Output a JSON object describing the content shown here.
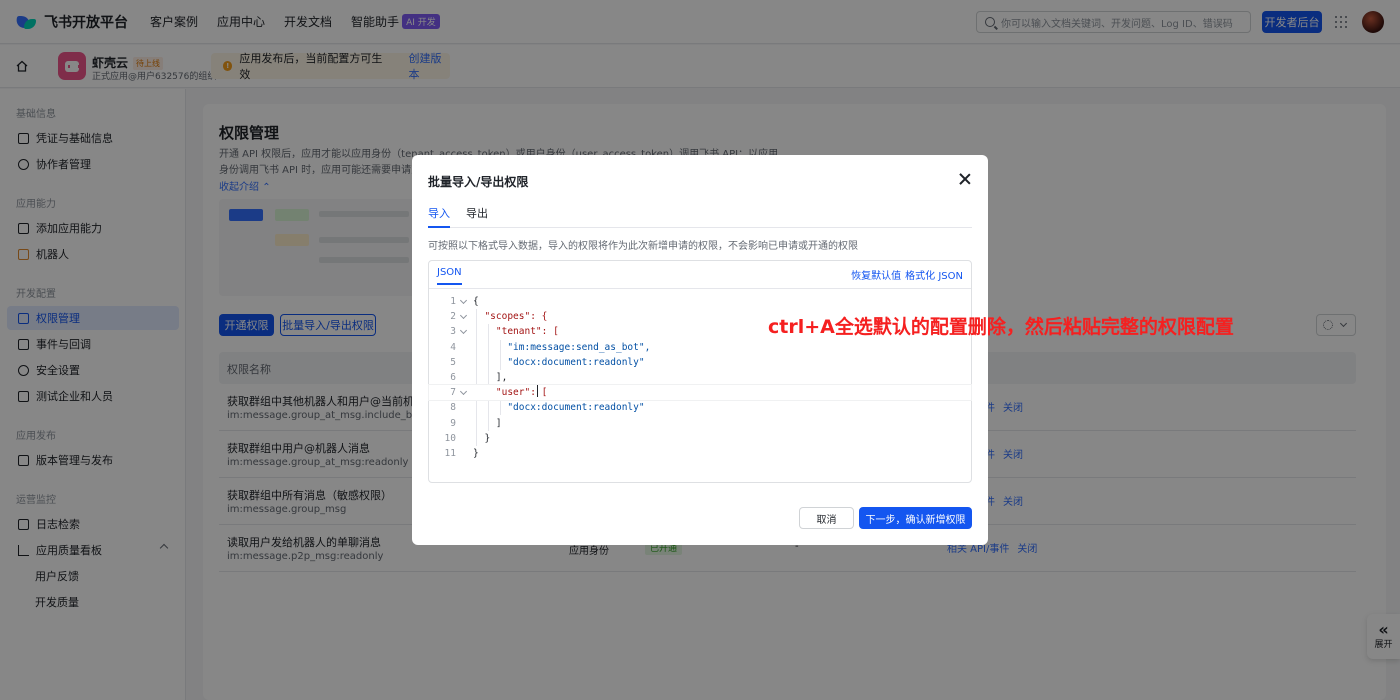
{
  "topnav": {
    "logo_text": "飞书开放平台",
    "links": [
      "客户案例",
      "应用中心",
      "开发文档",
      "智能助手"
    ],
    "ai_badge": "AI 开发",
    "search_placeholder": "你可以输入文档关键词、开发问题、Log ID、错误码",
    "dev_console": "开发者后台"
  },
  "app": {
    "name": "虾壳云",
    "status": "待上线",
    "org": "正式应用@用户632576的组织",
    "notice": "应用发布后，当前配置方可生效",
    "notice_link": "创建版本"
  },
  "sidebar": {
    "groups": [
      "基础信息",
      "应用能力",
      "开发配置",
      "应用发布",
      "运营监控"
    ],
    "items": [
      "凭证与基础信息",
      "协作者管理",
      "添加应用能力",
      "机器人",
      "权限管理",
      "事件与回调",
      "安全设置",
      "测试企业和人员",
      "版本管理与发布",
      "日志检索",
      "应用质量看板",
      "用户反馈",
      "开发质量"
    ]
  },
  "page": {
    "title": "权限管理",
    "desc": "开通 API 权限后，应用才能以应用身份（tenant_access_token）或用户身份（user_access_token）调用飞书 API；以应用身份调用飞书 API 时，应用可能还需要申请对应的数据权限",
    "collapse": "收起介绍",
    "btn_open": "开通权限",
    "btn_batch": "批量导入/导出权限",
    "th_name": "权限名称",
    "rows": [
      {
        "name": "获取群组中其他机器人和用户@当前机器人的消息",
        "code": "im:message.group_at_msg.include_bot:readonly",
        "type": "",
        "status": "",
        "dash": "",
        "act1": "事件",
        "act2": "关闭"
      },
      {
        "name": "获取群组中用户@机器人消息",
        "code": "im:message.group_at_msg:readonly",
        "type": "",
        "status": "",
        "dash": "",
        "act1": "事件",
        "act2": "关闭"
      },
      {
        "name": "获取群组中所有消息（敏感权限）",
        "code": "im:message.group_msg",
        "type": "",
        "status": "",
        "dash": "",
        "act1": "事件",
        "act2": "关闭"
      },
      {
        "name": "读取用户发给机器人的单聊消息",
        "code": "im:message.p2p_msg:readonly",
        "type": "应用身份",
        "status": "已开通",
        "dash": "-",
        "act1": "相关 API/事件",
        "act2": "关闭"
      }
    ]
  },
  "expand_label": "展开",
  "modal": {
    "title": "批量导入/导出权限",
    "tabs": [
      "导入",
      "导出"
    ],
    "desc": "可按照以下格式导入数据，导入的权限将作为此次新增申请的权限，不会影响已申请或开通的权限",
    "editor_tab": "JSON",
    "reset": "恢复默认值",
    "format": "格式化 JSON",
    "code_lines": [
      {
        "n": "1",
        "t": "{"
      },
      {
        "n": "2",
        "t": "  \"scopes\": {"
      },
      {
        "n": "3",
        "t": "    \"tenant\": ["
      },
      {
        "n": "4",
        "t": "      \"im:message:send_as_bot\","
      },
      {
        "n": "5",
        "t": "      \"docx:document:readonly\""
      },
      {
        "n": "6",
        "t": "    ],"
      },
      {
        "n": "7",
        "t": "    \"user\": ["
      },
      {
        "n": "8",
        "t": "      \"docx:document:readonly\""
      },
      {
        "n": "9",
        "t": "    ]"
      },
      {
        "n": "10",
        "t": "  }"
      },
      {
        "n": "11",
        "t": "}"
      }
    ],
    "cancel": "取消",
    "next": "下一步，确认新增权限"
  },
  "annotation": "ctrl+A全选默认的配置删除，然后粘贴完整的权限配置"
}
